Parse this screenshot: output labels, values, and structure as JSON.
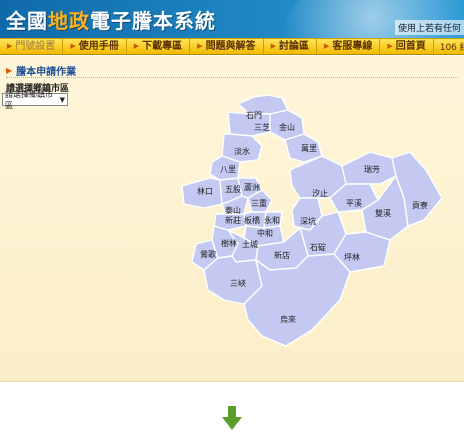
{
  "header": {
    "title_parts": [
      "全國",
      "地政",
      "電子謄本系統"
    ],
    "user_note": "使用上若有任何"
  },
  "nav": {
    "items": [
      "門號設置",
      "使用手冊",
      "下載專區",
      "問題與解答",
      "討論區",
      "客服專線",
      "回首頁"
    ],
    "online_count": "106 線"
  },
  "content": {
    "breadcrumb": "謄本申請作業",
    "town_label": "請選擇鄉鎮市區",
    "town_select_value": "請選擇鄉鎮市區"
  },
  "map": {
    "fill_color": "#c3c9f1",
    "districts": [
      "石門",
      "三芝",
      "金山",
      "淡水",
      "萬里",
      "八里",
      "汐止",
      "瑞芳",
      "林口",
      "五股",
      "蘆洲",
      "三重",
      "泰山",
      "新莊",
      "板橋",
      "永和",
      "中和",
      "深坑",
      "平溪",
      "雙溪",
      "貢寮",
      "鶯歌",
      "樹林",
      "土城",
      "石碇",
      "坪林",
      "新店",
      "三峽",
      "烏來"
    ]
  },
  "colors": {
    "header_blue": "#1f86c4",
    "nav_yellow": "#f2b900",
    "arrow_green": "#5a9e2a"
  }
}
